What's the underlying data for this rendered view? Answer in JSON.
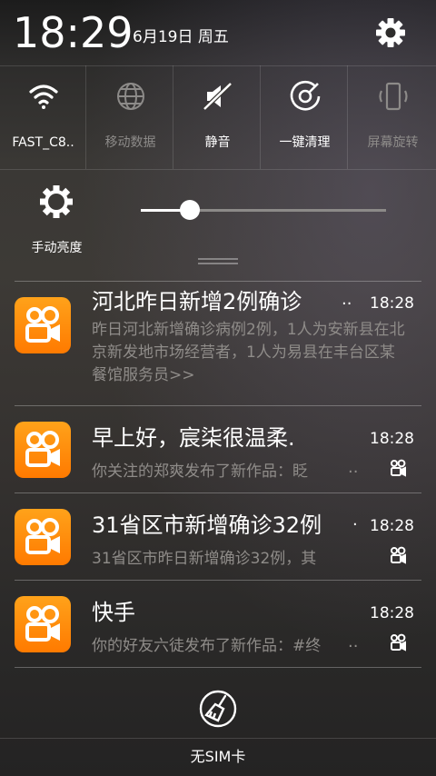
{
  "status": {
    "time": "18:29",
    "date": "6月19日 周五"
  },
  "toggles": [
    {
      "label": "FAST_C8..",
      "icon": "wifi-icon",
      "active": true
    },
    {
      "label": "移动数据",
      "icon": "globe-icon",
      "active": false
    },
    {
      "label": "静音",
      "icon": "mute-icon",
      "active": true
    },
    {
      "label": "一键清理",
      "icon": "cleanup-icon",
      "active": true
    },
    {
      "label": "屏幕旋转",
      "icon": "rotate-icon",
      "active": false
    }
  ],
  "brightness": {
    "label": "手动亮度",
    "level": 0.2
  },
  "notifications": [
    {
      "title": "河北昨日新增2例确诊",
      "time": "18:28",
      "dots": "··",
      "body": "昨日河北新增确诊病例2例，1人为安新县在北京新发地市场经营者，1人为易县在丰台区某餐馆服务员>>"
    },
    {
      "title": "早上好，宸柒很温柔.",
      "time": "18:28",
      "dots": "··",
      "body": "你关注的郑爽发布了新作品：眨"
    },
    {
      "title": "31省区市新增确诊32例",
      "time": "18:28",
      "dots": "·",
      "body": "31省区市昨日新增确诊32例，其"
    },
    {
      "title": "快手",
      "time": "18:28",
      "dots": "··",
      "body": "你的好友六徒发布了新作品：#终"
    }
  ],
  "footer": {
    "text": "无SIM卡"
  },
  "colors": {
    "accent": "#ff8c00",
    "muted_text": "#8f8c89"
  }
}
